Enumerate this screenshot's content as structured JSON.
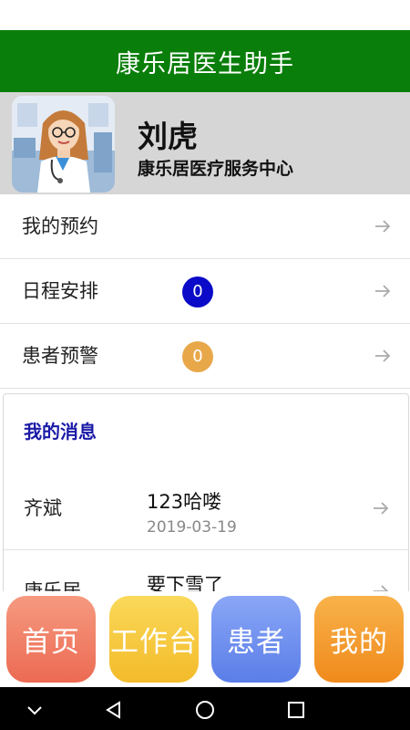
{
  "app": {
    "title": "康乐居医生助手"
  },
  "profile": {
    "name": "刘虎",
    "org": "康乐居医疗服务中心"
  },
  "menu": [
    {
      "label": "我的预约",
      "badge": null
    },
    {
      "label": "日程安排",
      "badge": "0",
      "badge_color": "#0a0ac8"
    },
    {
      "label": "患者预警",
      "badge": "0",
      "badge_color": "#e8a84a"
    }
  ],
  "messages": {
    "title": "我的消息",
    "items": [
      {
        "sender": "齐斌",
        "text": "123哈喽",
        "date": "2019-03-19"
      },
      {
        "sender": "康乐居",
        "text": "要下雪了",
        "date": ""
      }
    ]
  },
  "tabs": [
    {
      "label": "首页",
      "color": "#f07a62"
    },
    {
      "label": "工作台",
      "color": "#f6c93a"
    },
    {
      "label": "患者",
      "color": "#6e8ef2"
    },
    {
      "label": "我的",
      "color": "#f49a2a"
    }
  ],
  "nav": {
    "icons": [
      "chevron-down-icon",
      "back-icon",
      "home-icon",
      "recents-icon"
    ]
  }
}
